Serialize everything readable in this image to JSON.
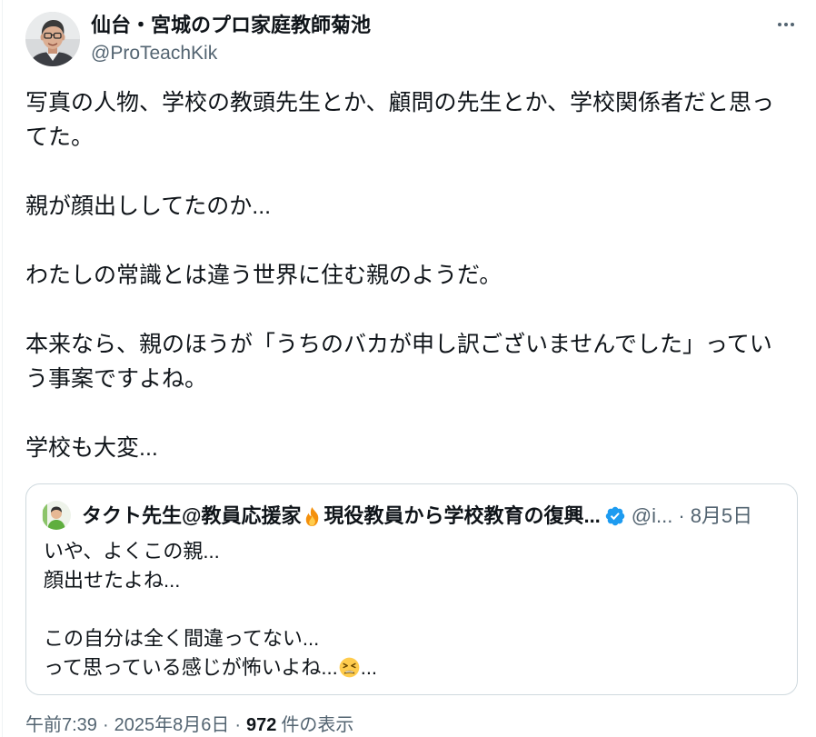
{
  "author": {
    "display_name": "仙台・宮城のプロ家庭教師菊池",
    "handle": "@ProTeachKik"
  },
  "more_icon": "more-horizontal-icon",
  "tweet": {
    "paragraphs": [
      [
        "写真の人物、学校の教頭先生とか、顧問の先生とか、学校関係者だと思っ",
        "てた。"
      ],
      [
        "親が顔出ししてたのか..."
      ],
      [
        "わたしの常識とは違う世界に住む親のようだ。"
      ],
      [
        "本来なら、親のほうが「うちのバカが申し訳ございませんでした」ってい",
        "う事案ですよね。"
      ],
      [
        "学校も大変..."
      ]
    ]
  },
  "quote": {
    "name_part_1": "タクト先生@教員応援家",
    "name_emoji": "fire-emoji",
    "name_part_2": "現役教員から学校教育の復興...",
    "verified_icon": "verified-badge-icon",
    "handle": "@i...",
    "separator": "·",
    "date": "8月5日",
    "paragraphs": [
      [
        "いや、よくこの親...",
        "顔出せたよね..."
      ],
      [
        "この自分は全く間違ってない...",
        "って思っている感じが怖いよね..."
      ]
    ],
    "last_line_emoji": "tired-face-emoji",
    "last_line_suffix": "..."
  },
  "meta": {
    "time": "午前7:39",
    "separator": "·",
    "date": "2025年8月6日",
    "views_count": "972",
    "views_label": "件の表示"
  },
  "colors": {
    "text": "#0f1419",
    "secondary": "#536471",
    "border": "#cfd9de",
    "verified": "#1d9bf0"
  }
}
